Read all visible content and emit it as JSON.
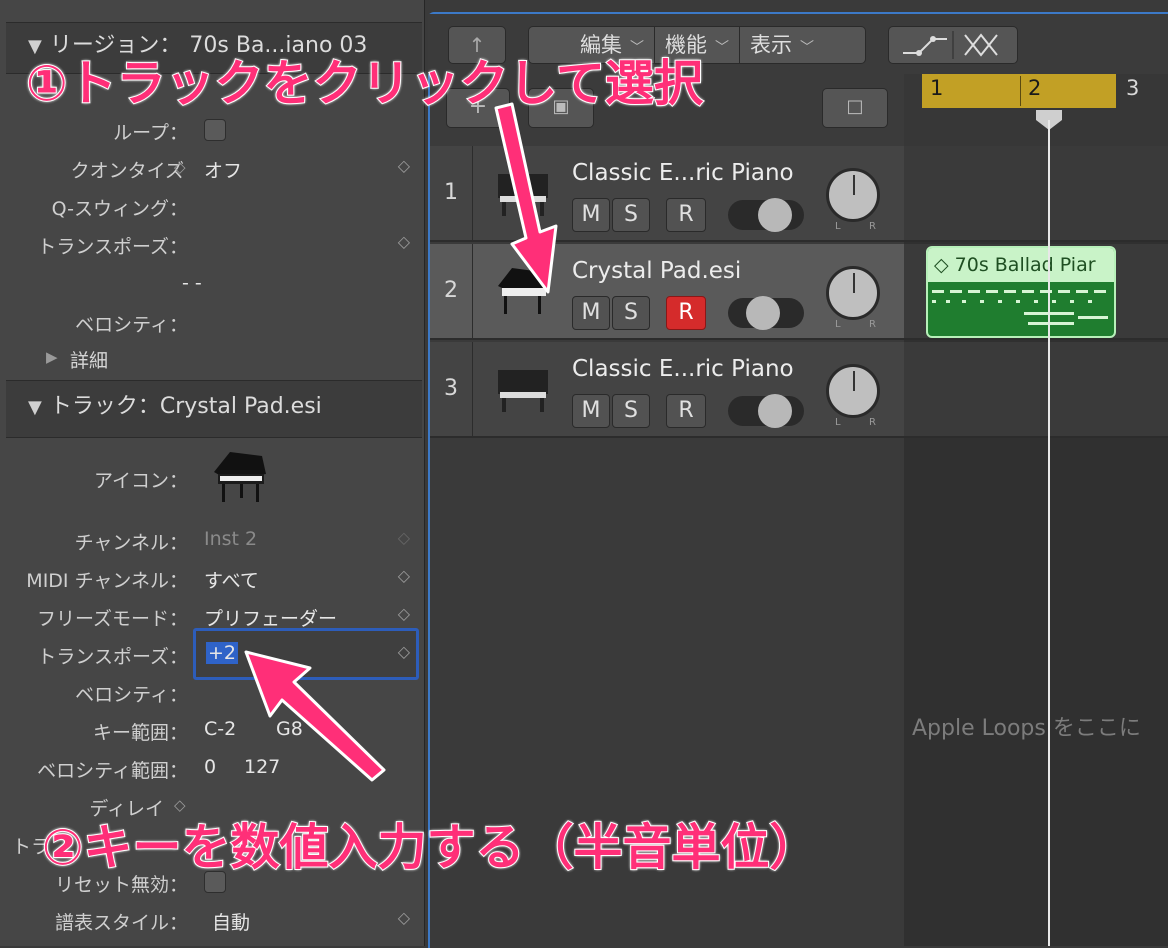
{
  "inspector": {
    "region_header": {
      "label": "リージョン：",
      "name": "70s Ba...iano 03"
    },
    "region_rows": [
      {
        "label": "ループ：",
        "value": ""
      },
      {
        "label": "クオンタイズ",
        "value": "オフ"
      },
      {
        "label": "Q-スウィング：",
        "value": ""
      },
      {
        "label": "トランスポーズ：",
        "value": ""
      },
      {
        "label": "",
        "value": "- -"
      },
      {
        "label": "ベロシティ：",
        "value": ""
      }
    ],
    "details_label": "詳細",
    "track_header": {
      "label": "トラック：",
      "name": "Crystal Pad.esi"
    },
    "track_rows": {
      "icon_label": "アイコン：",
      "channel": {
        "label": "チャンネル：",
        "value": "Inst 2"
      },
      "midi_channel": {
        "label": "MIDI チャンネル：",
        "value": "すべて"
      },
      "freeze_mode": {
        "label": "フリーズモード：",
        "value": "プリフェーダー"
      },
      "transpose": {
        "label": "トランスポーズ：",
        "value": "+2"
      },
      "velocity": {
        "label": "ベロシティ：",
        "value": ""
      },
      "key_range": {
        "label": "キー範囲：",
        "low": "C-2",
        "high": "G8"
      },
      "velocity_range": {
        "label": "ベロシティ範囲：",
        "low": "0",
        "high": "127"
      },
      "delay": {
        "label": "ディレイ",
        "value": ""
      },
      "track_cut": {
        "label": "トラ",
        "value": ""
      },
      "reset_disable": {
        "label": "リセット無効：",
        "value": ""
      },
      "score_style": {
        "label": "譜表スタイル：",
        "value": "自動"
      }
    }
  },
  "toolbar": {
    "up_icon": "↑",
    "menus": [
      "編集",
      "機能",
      "表示"
    ],
    "automation_icon": "automation-curve-icon",
    "flex_icon": "flex-icon"
  },
  "tracks": [
    {
      "number": "1",
      "name": "Classic E...ric Piano",
      "m": "M",
      "s": "S",
      "r": "R",
      "rec": false
    },
    {
      "number": "2",
      "name": "Crystal Pad.esi",
      "m": "M",
      "s": "S",
      "r": "R",
      "rec": true
    },
    {
      "number": "3",
      "name": "Classic E...ric Piano",
      "m": "M",
      "s": "S",
      "r": "R",
      "rec": false
    }
  ],
  "knob_labels": {
    "left": "L",
    "right": "R"
  },
  "ruler": {
    "bars": [
      "1",
      "2",
      "3"
    ]
  },
  "region": {
    "title": "70s Ballad Piar"
  },
  "apple_loops": "Apple Loops をここに",
  "annotations": {
    "step1": "①トラックをクリックして選択",
    "step2": "②キーを数値入力する（半音単位）"
  },
  "colors": {
    "annotation": "#ff2f78",
    "record_on": "#d52b2b",
    "region": "#1f7d2f",
    "cycle": "#c2a025",
    "focus": "#2d5dba"
  }
}
